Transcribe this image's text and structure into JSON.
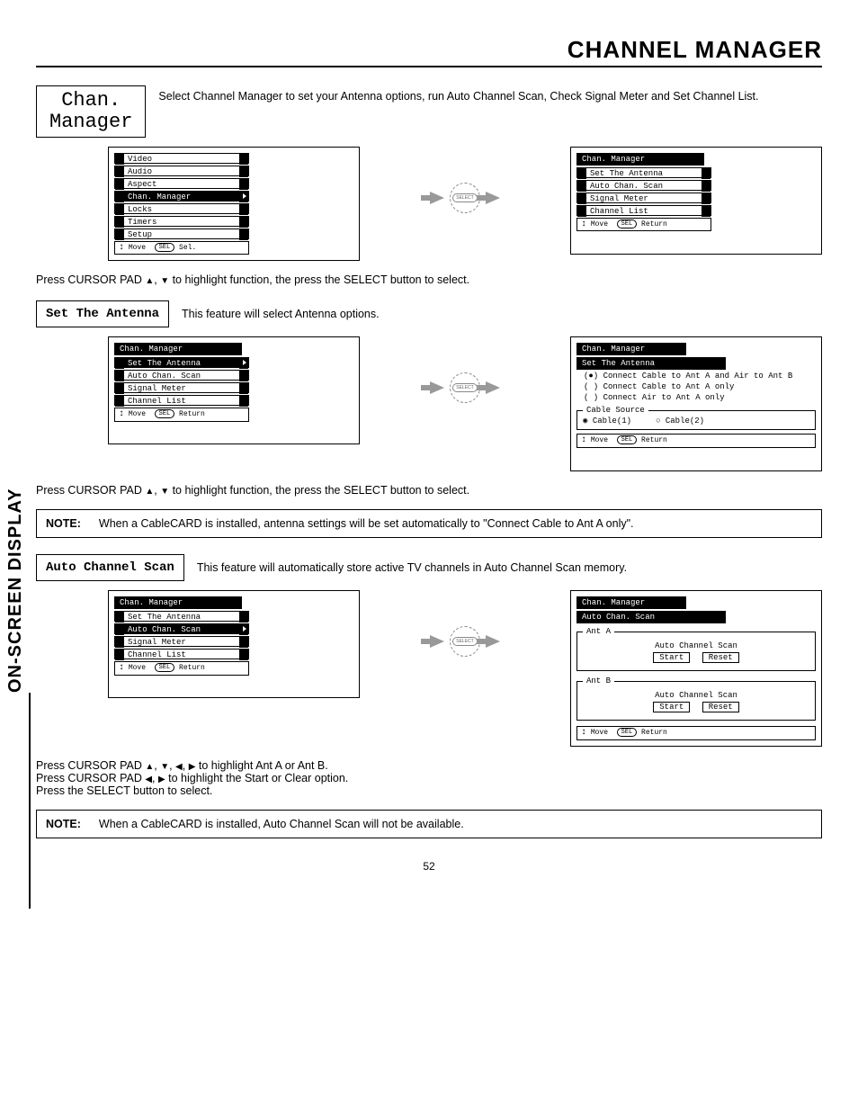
{
  "page_title": "CHANNEL MANAGER",
  "side_tab": "ON-SCREEN DISPLAY",
  "page_number": "52",
  "chan_box": {
    "line1": "Chan.",
    "line2": "Manager"
  },
  "intro_text": "Select Channel Manager to set your Antenna options, run Auto Channel Scan, Check Signal Meter and Set Channel List.",
  "select_btn": "SELECT",
  "main_menu": {
    "items": [
      "Video",
      "Audio",
      "Aspect",
      "Chan. Manager",
      "Locks",
      "Timers",
      "Setup"
    ],
    "highlighted_index": 3,
    "footer": "↕ Move   SEL  Sel."
  },
  "chan_menu": {
    "header": "Chan. Manager",
    "items": [
      "Set The Antenna",
      "Auto Chan. Scan",
      "Signal Meter",
      "Channel List"
    ],
    "footer": "↕ Move   SEL  Return"
  },
  "instruction1_a": "Press CURSOR PAD ",
  "instruction1_b": " to highlight function, the press the SELECT button to select.",
  "set_antenna": {
    "label": "Set The Antenna",
    "desc": "This feature will select Antenna options.",
    "left_menu_highlight": 0,
    "right": {
      "header": "Chan. Manager",
      "selected": "Set The Antenna",
      "radios": [
        {
          "mark": "(●)",
          "text": "Connect Cable to Ant A and Air to Ant B"
        },
        {
          "mark": "( )",
          "text": "Connect Cable to Ant A only"
        },
        {
          "mark": "( )",
          "text": "Connect Air to Ant A only"
        }
      ],
      "cable_legend": "Cable Source",
      "cable1_mark": "◉",
      "cable1": "Cable(1)",
      "cable2_mark": "○",
      "cable2": "Cable(2)",
      "footer": "↕ Move   SEL  Return"
    }
  },
  "instruction2_a": "Press CURSOR PAD ",
  "instruction2_b": " to highlight function, the press the SELECT button to select.",
  "note1": {
    "label": "NOTE:",
    "text": "When a CableCARD is installed, antenna settings will be set automatically to \"Connect Cable to Ant A only\"."
  },
  "auto_scan": {
    "label": "Auto Channel Scan",
    "desc": "This feature will automatically store active TV channels in Auto Channel Scan memory.",
    "left_menu_highlight": 1,
    "right": {
      "header": "Chan. Manager",
      "selected": "Auto Chan. Scan",
      "antA": "Ant A",
      "antB": "Ant B",
      "scan_label": "Auto Channel Scan",
      "start": "Start",
      "reset": "Reset",
      "footer": "↕ Move   SEL  Return"
    }
  },
  "instruction3": {
    "l1a": "Press CURSOR PAD ",
    "l1b": " to highlight Ant A or Ant B.",
    "l2a": "Press CURSOR PAD ",
    "l2b": " to highlight the Start or Clear option.",
    "l3": "Press the SELECT button to select."
  },
  "note2": {
    "label": "NOTE:",
    "text": "When a CableCARD is installed, Auto Channel Scan will not be available."
  },
  "arrows": {
    "up": "▲",
    "down": "▼",
    "left": "◀",
    "right": "▶"
  }
}
